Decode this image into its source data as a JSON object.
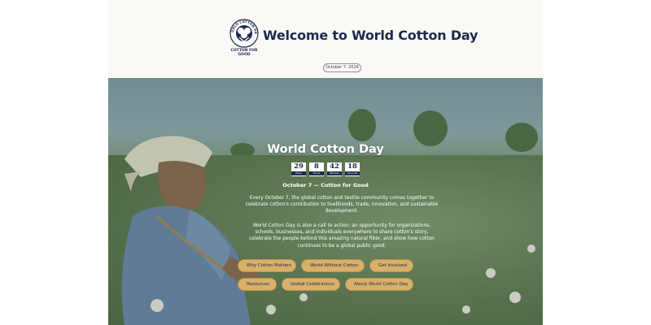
{
  "header": {
    "logo_top_text": "WORLD COTTON DAY",
    "logo_bottom_text": "COTTON FOR GOOD",
    "title": "Welcome to World Cotton Day",
    "date": "October 7, 2026"
  },
  "hero": {
    "title": "World Cotton Day",
    "countdown": [
      {
        "value": "29",
        "label": "Days"
      },
      {
        "value": "8",
        "label": "Hours"
      },
      {
        "value": "42",
        "label": "Minutes"
      },
      {
        "value": "18",
        "label": "Seconds"
      }
    ],
    "tagline": "October 7 — Cotton for Good",
    "paragraph1": "Every October 7, the global cotton and textile community comes together to celebrate cotton's contribution to livelihoods, trade, innovation, and sustainable development.",
    "paragraph2": "World Cotton Day is also a call to action: an opportunity for organizations, schools, businesses, and individuals everywhere to share cotton's story, celebrate the people behind this amazing natural fiber, and show how cotton continues to be a global public good.",
    "buttons_row1": [
      "Why Cotton Matters",
      "World Without Cotton",
      "Get Involved"
    ],
    "buttons_row2": [
      "Resources",
      "Global Celebrations",
      "About World Cotton Day"
    ]
  },
  "colors": {
    "navy": "#1b2a4e",
    "button": "#d9b06a",
    "header_bg": "#fbf9f5"
  }
}
